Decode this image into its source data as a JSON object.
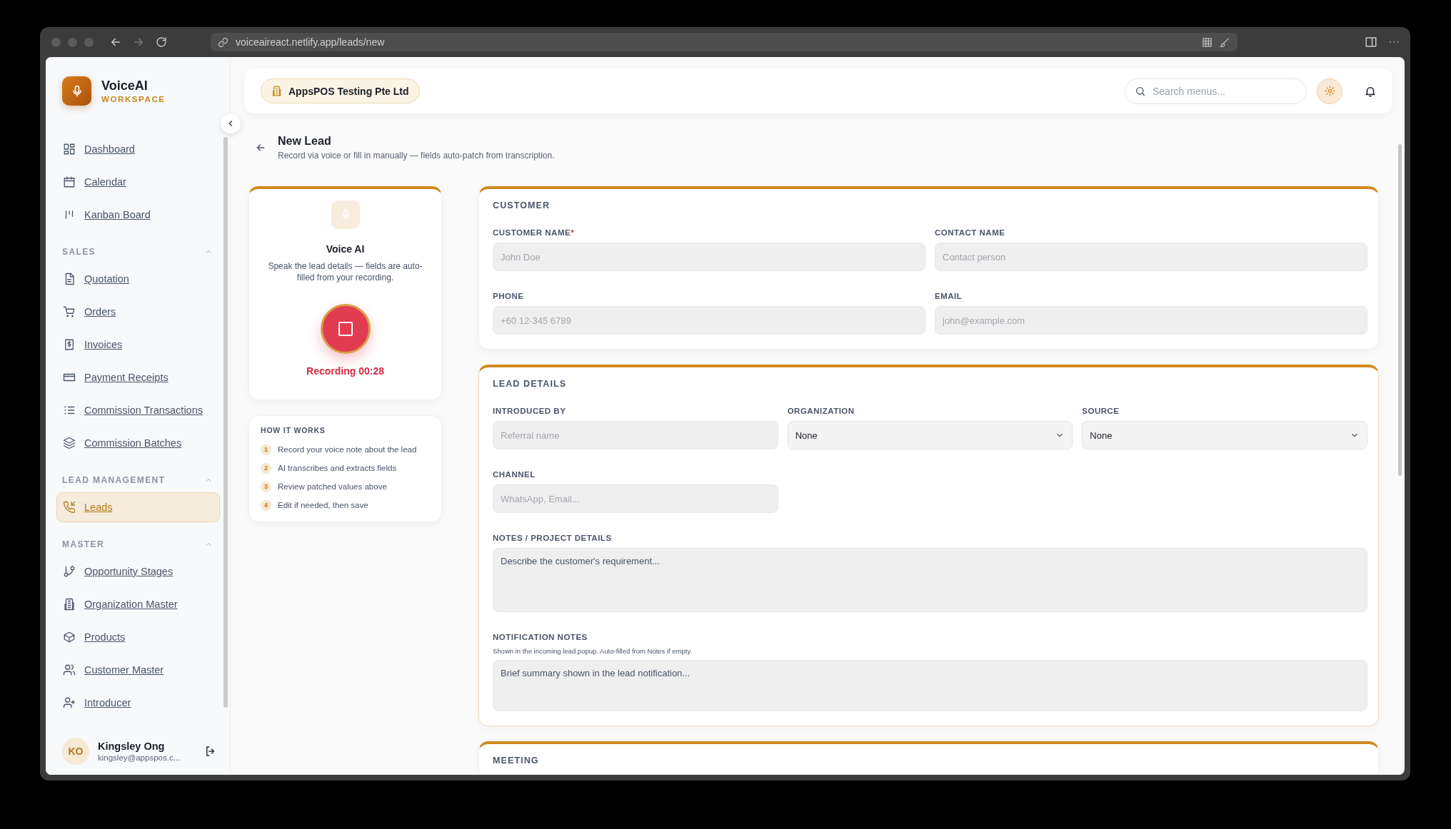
{
  "browser": {
    "url": "voiceaireact.netlify.app/leads/new"
  },
  "sidebar": {
    "brand": {
      "name": "VoiceAI",
      "subtitle": "WORKSPACE"
    },
    "groups": [
      {
        "items": [
          {
            "label": "Dashboard",
            "selected": false
          },
          {
            "label": "Calendar",
            "selected": false
          },
          {
            "label": "Kanban Board",
            "selected": false
          }
        ]
      },
      {
        "title": "SALES",
        "expanded": true,
        "items": [
          {
            "label": "Quotation",
            "selected": false
          },
          {
            "label": "Orders",
            "selected": false
          },
          {
            "label": "Invoices",
            "selected": false
          },
          {
            "label": "Payment Receipts",
            "selected": false
          },
          {
            "label": "Commission Transactions",
            "selected": false
          },
          {
            "label": "Commission Batches",
            "selected": false
          }
        ]
      },
      {
        "title": "LEAD MANAGEMENT",
        "expanded": true,
        "items": [
          {
            "label": "Leads",
            "selected": true
          }
        ]
      },
      {
        "title": "MASTER",
        "expanded": true,
        "items": [
          {
            "label": "Opportunity Stages",
            "selected": false
          },
          {
            "label": "Organization Master",
            "selected": false
          },
          {
            "label": "Products",
            "selected": false
          },
          {
            "label": "Customer Master",
            "selected": false
          },
          {
            "label": "Introducer",
            "selected": false
          }
        ]
      }
    ],
    "user": {
      "initials": "KO",
      "name": "Kingsley Ong",
      "email": "kingsley@appspos.c..."
    }
  },
  "header": {
    "organization": "AppsPOS Testing Pte Ltd",
    "search": {
      "placeholder": "Search menus..."
    }
  },
  "page": {
    "title": "New Lead",
    "subtitle": "Record via voice or fill in manually — fields auto-patch from transcription."
  },
  "voice": {
    "title": "Voice AI",
    "description": "Speak the lead details — fields are auto-filled from your recording.",
    "recording": true,
    "status": "Recording 00:28"
  },
  "how_it_works": {
    "title": "HOW IT WORKS",
    "steps": [
      {
        "number": "1",
        "text": "Record your voice note about the lead"
      },
      {
        "number": "2",
        "text": "AI transcribes and extracts fields"
      },
      {
        "number": "3",
        "text": "Review patched values above"
      },
      {
        "number": "4",
        "text": "Edit if needed, then save"
      }
    ]
  },
  "sections": [
    {
      "title": "CUSTOMER",
      "fields": [
        {
          "kind": "input",
          "label": "CUSTOMER NAME",
          "required_mark": "*",
          "placeholder": "John Doe"
        },
        {
          "kind": "input",
          "label": "CONTACT NAME",
          "placeholder": "Contact person"
        },
        {
          "kind": "input",
          "label": "PHONE",
          "placeholder": "+60 12-345 6789"
        },
        {
          "kind": "input",
          "label": "EMAIL",
          "placeholder": "john@example.com"
        }
      ]
    },
    {
      "title": "LEAD DETAILS",
      "fields": [
        {
          "kind": "input",
          "label": "INTRODUCED BY",
          "placeholder": "Referral name"
        },
        {
          "kind": "select",
          "label": "ORGANIZATION",
          "value": "None"
        },
        {
          "kind": "select",
          "label": "SOURCE",
          "value": "None"
        },
        {
          "kind": "input",
          "label": "CHANNEL",
          "placeholder": "WhatsApp, Email..."
        },
        {
          "kind": "textarea",
          "label": "NOTES / PROJECT DETAILS",
          "placeholder": "Describe the customer's requirement..."
        },
        {
          "kind": "textarea",
          "label": "NOTIFICATION NOTES",
          "hint": "Shown in the incoming lead popup. Auto-filled from Notes if empty.",
          "placeholder": "Brief summary shown in the lead notification..."
        }
      ]
    },
    {
      "title": "MEETING"
    }
  ]
}
